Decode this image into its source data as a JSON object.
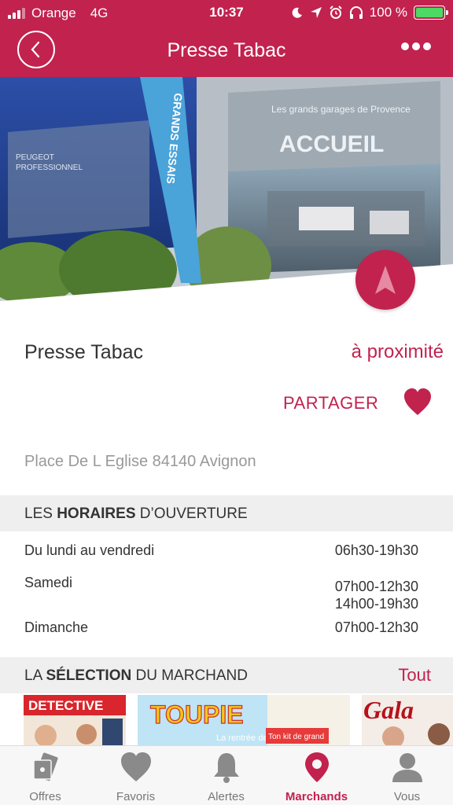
{
  "status_bar": {
    "carrier": "Orange",
    "network": "4G",
    "time": "10:37",
    "battery": "100 %",
    "icons": [
      "moon-icon",
      "location-arrow-icon",
      "alarm-icon",
      "headphones-icon",
      "battery-icon"
    ]
  },
  "header": {
    "title": "Presse Tabac",
    "back_icon": "chevron-left-icon",
    "more_icon": "ellipsis-icon"
  },
  "hero": {
    "photo_text_accueil": "ACCUEIL",
    "photo_text_banner": "Les grands garages de Provence",
    "photo_text_flag": "GRANDS ESSAIS",
    "photo_text_peugeot": "PEUGEOT",
    "photo_text_pro": "PROFESSIONNEL",
    "fab_icon": "navigation-arrow-icon"
  },
  "merchant": {
    "name": "Presse Tabac",
    "proximity": "à proximité",
    "share_label": "PARTAGER",
    "favorite_icon": "heart-icon",
    "address": "Place De L Eglise 84140 Avignon"
  },
  "hours_section": {
    "title_pre": "LES ",
    "title_bold": "HORAIRES",
    "title_post": " D’OUVERTURE",
    "rows": [
      {
        "day": "Du lundi au vendredi",
        "line1": "06h30-19h30",
        "line2": ""
      },
      {
        "day": "Samedi",
        "line1": "07h00-12h30",
        "line2": "14h00-19h30"
      },
      {
        "day": "Dimanche",
        "line1": "07h00-12h30",
        "line2": ""
      }
    ]
  },
  "selection_section": {
    "title_pre": "LA ",
    "title_bold": "SÉLECTION",
    "title_post": " DU MARCHAND",
    "all_link": "Tout",
    "items": [
      {
        "name": "DETECTIVE",
        "color": "#d8262c"
      },
      {
        "name": "TOUPIE",
        "subtitle": "La rentrée de",
        "badge": "Ton kit de grand",
        "color": "#2a9fd8"
      },
      {
        "name": "Gala",
        "color": "#b5121b"
      }
    ]
  },
  "tabbar": {
    "tabs": [
      {
        "label": "Offres",
        "icon": "offers-tag-icon",
        "active": false
      },
      {
        "label": "Favoris",
        "icon": "heart-icon",
        "active": false
      },
      {
        "label": "Alertes",
        "icon": "bell-icon",
        "active": false
      },
      {
        "label": "Marchands",
        "icon": "map-pin-icon",
        "active": true
      },
      {
        "label": "Vous",
        "icon": "user-icon",
        "active": false
      }
    ]
  },
  "colors": {
    "brand": "#c2224e",
    "section_bg": "#efefef",
    "muted_text": "#999999",
    "tab_inactive": "#8a8a8a"
  }
}
